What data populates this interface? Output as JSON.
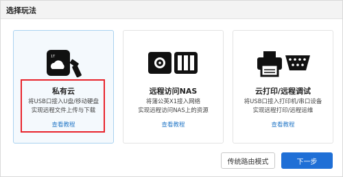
{
  "dialog": {
    "title": "选择玩法"
  },
  "cards": [
    {
      "icon": "cloud-usb-icon",
      "name": "私有云",
      "desc_line1": "将USB口接入U盘/移动硬盘",
      "desc_line2": "实现远程文件上传与下载",
      "link": "查看教程",
      "selected": true
    },
    {
      "icon": "nas-icon",
      "name": "远程访问NAS",
      "desc_line1": "将蒲公英X1接入网络",
      "desc_line2": "实现远程访问NAS上的资源",
      "link": "查看教程",
      "selected": false
    },
    {
      "icon": "printer-serial-icon",
      "name": "云打印/远程调试",
      "desc_line1": "将USB口接入打印机/串口设备",
      "desc_line2": "实现远程打印/远程运维",
      "link": "查看教程",
      "selected": false
    }
  ],
  "buttons": {
    "legacy": "传统路由模式",
    "next": "下一步"
  },
  "colors": {
    "accent": "#1f6fd6",
    "link": "#2a7bc8",
    "highlight": "#e8222a",
    "selected_bg": "#f4f9fd"
  }
}
